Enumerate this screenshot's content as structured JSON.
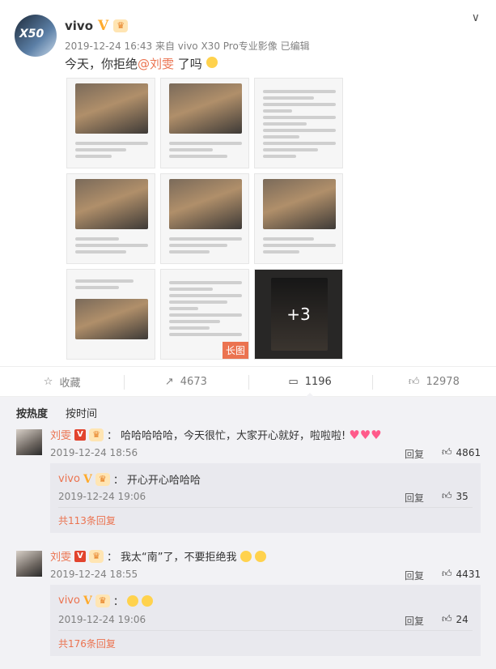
{
  "post": {
    "avatar_text": "X50",
    "author": "vivo",
    "verified_mark": "V",
    "meta": "2019-12-24 16:43 来自 vivo X30 Pro专业影像  已编辑",
    "text_before": "今天，你拒绝",
    "mention": "@刘雯",
    "text_after": " 了吗",
    "more_count": "+3",
    "long_image_tag": "长图"
  },
  "actions": {
    "favorite": "收藏",
    "repost_count": "4673",
    "comment_count": "1196",
    "like_count": "12978"
  },
  "sort": {
    "hot": "按热度",
    "time": "按时间"
  },
  "comments": [
    {
      "name": "刘雯",
      "text": "哈哈哈哈哈，今天很忙，大家开心就好，啦啦啦!",
      "time": "2019-12-24 18:56",
      "reply_label": "回复",
      "likes": "4861",
      "sub": {
        "name": "vivo",
        "text": "开心开心哈哈哈",
        "time": "2019-12-24 19:06",
        "reply_label": "回复",
        "likes": "35",
        "more": "共113条回复"
      }
    },
    {
      "name": "刘雯",
      "text": "我太“南”了，不要拒绝我",
      "time": "2019-12-24 18:55",
      "reply_label": "回复",
      "likes": "4431",
      "sub": {
        "name": "vivo",
        "text": "",
        "time": "2019-12-24 19:06",
        "reply_label": "回复",
        "likes": "24",
        "more": "共176条回复"
      }
    }
  ],
  "colors": {
    "accent": "#eb7350",
    "verified": "#ffab2d",
    "comment_bg": "#f2f2f5"
  }
}
